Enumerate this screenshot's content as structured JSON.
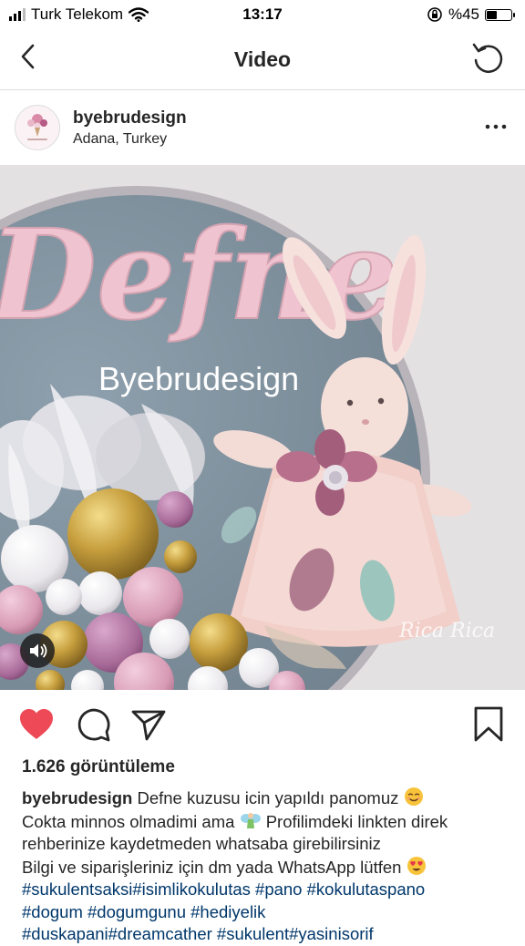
{
  "status_bar": {
    "carrier": "Turk Telekom",
    "time": "13:17",
    "battery": "%45",
    "battery_level": 0.45
  },
  "nav": {
    "title": "Video",
    "back_icon": "chevron-left-icon",
    "refresh_icon": "refresh-icon"
  },
  "post_header": {
    "username": "byebrudesign",
    "location": "Adana, Turkey",
    "more_icon": "more-horizontal-icon"
  },
  "media": {
    "overlay_title": "Defne",
    "overlay_brand": "Byebrudesign",
    "watermark": "Rica Rica",
    "sound_icon": "speaker-icon"
  },
  "actions": {
    "like_icon": "heart-filled-icon",
    "comment_icon": "comment-icon",
    "share_icon": "send-icon",
    "save_icon": "bookmark-icon",
    "like_color": "#ed4956"
  },
  "views": {
    "label": "1.626 görüntüleme"
  },
  "caption": {
    "username": "byebrudesign",
    "line1": "Defne kuzusu icin yapıldı panomuz",
    "line2a": "Cokta minnos olmadimi ama",
    "line2b": "Profilimdeki linkten direk",
    "line3": "rehberinize kaydetmeden whatsaba girebilirsiniz",
    "line4": "Bilgi ve siparişleriniz için dm yada WhatsApp lütfen",
    "tags1": "#sukulentsaksi#isimlikokulutas #pano #kokulutaspano",
    "tags2": "#dogum #dogumgunu #hediyelik",
    "tags3": "#duskapani#dreamcather #sukulent#yasinisorif"
  }
}
